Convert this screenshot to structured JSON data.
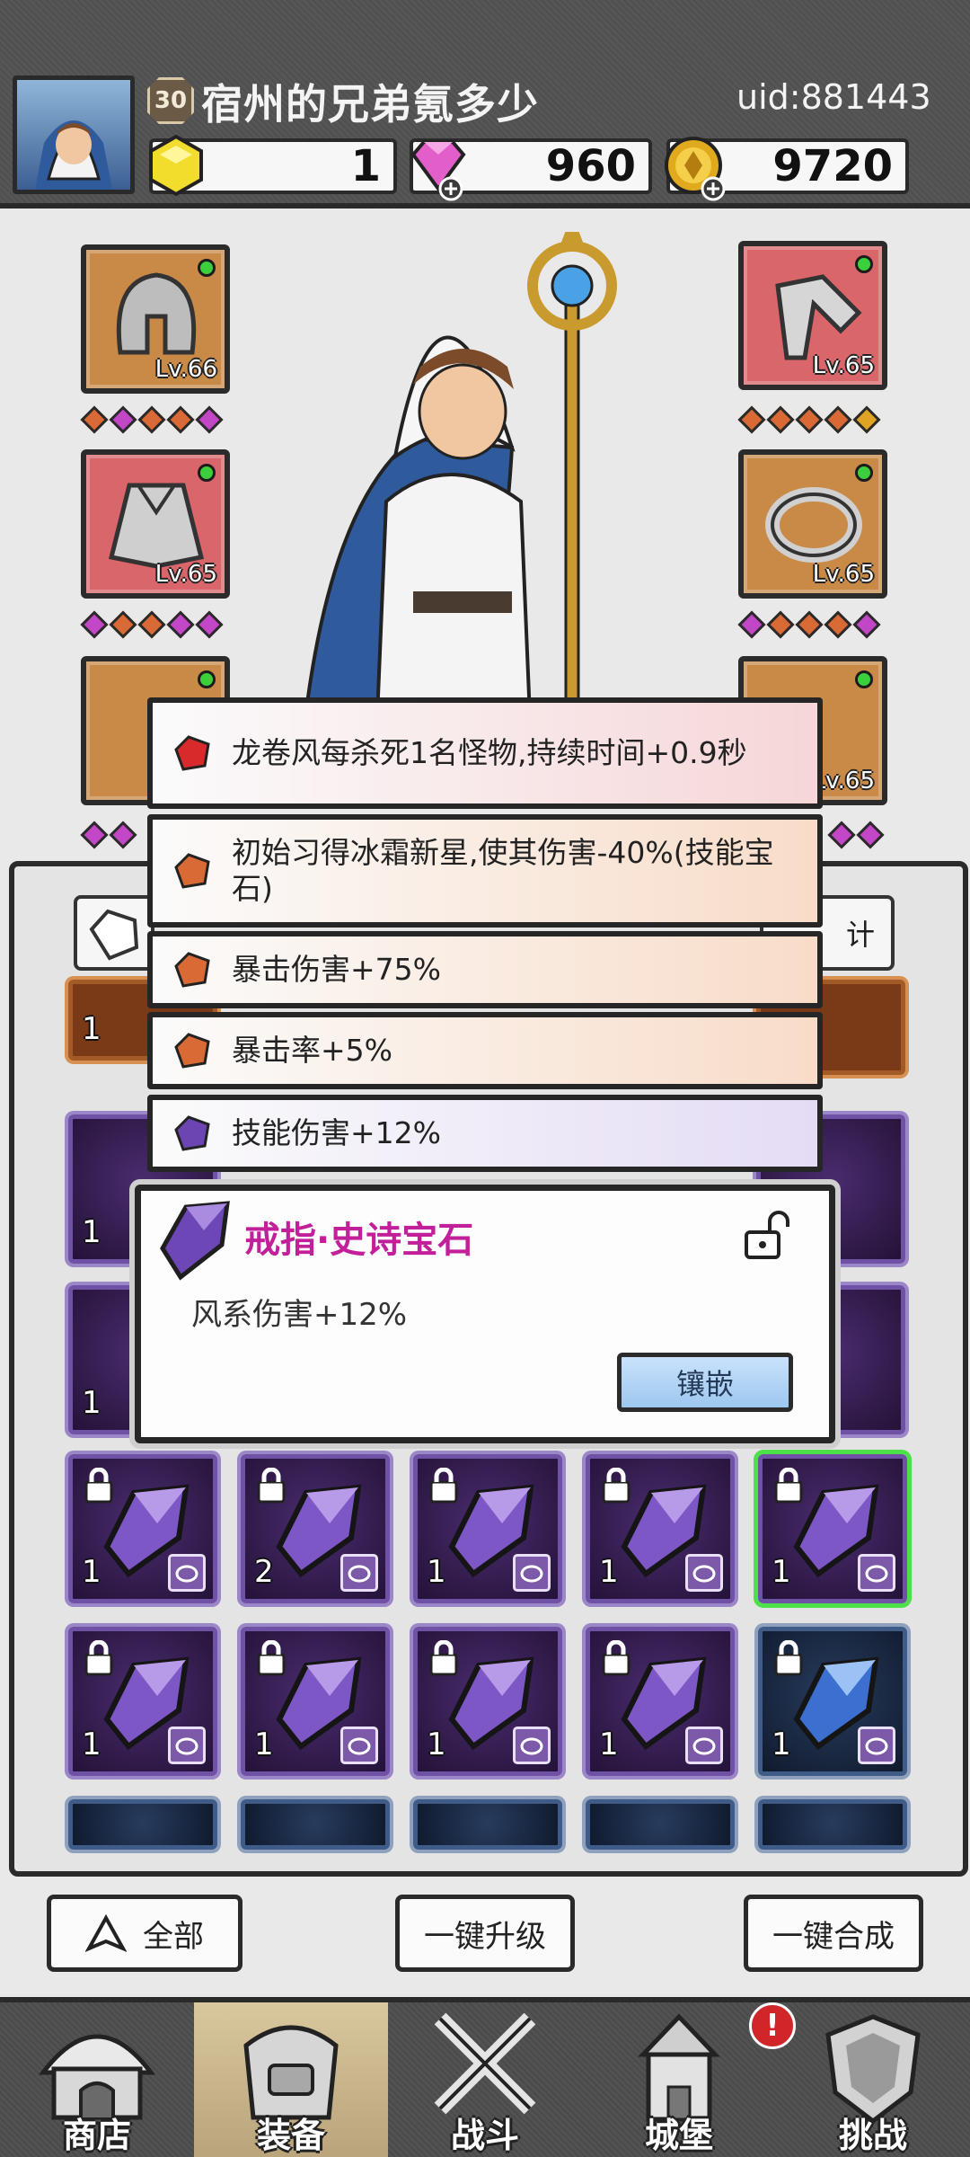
{
  "player": {
    "level": "30",
    "name": "宿州的兄弟氪多少",
    "uid": "uid:881443"
  },
  "resources": {
    "yellow_gem": "1",
    "diamond": "960",
    "gold": "9720"
  },
  "equipment": {
    "left": [
      {
        "name": "helmet",
        "level": "Lv.66"
      },
      {
        "name": "cloak",
        "level": "Lv.65"
      }
    ],
    "right": [
      {
        "name": "boots",
        "level": "Lv.65"
      },
      {
        "name": "ring",
        "level": "Lv.65"
      },
      {
        "name": "necklace",
        "level": "Lv.65"
      }
    ]
  },
  "affixes": [
    {
      "text": "龙卷风每杀死1名怪物,持续时间+0.9秒",
      "color": "#d8292b"
    },
    {
      "text": "初始习得冰霜新星,使其伤害-40%(技能宝石)",
      "color": "#d96a35"
    },
    {
      "text": "暴击伤害+75%",
      "color": "#d96a35"
    },
    {
      "text": "暴击率+5%",
      "color": "#d96a35"
    },
    {
      "text": "技能伤害+12%",
      "color": "#6c45b2"
    }
  ],
  "partial_button_text": "计",
  "gem_popup": {
    "title": "戒指·史诗宝石",
    "effect": "风系伤害+12%",
    "inlay_button": "镶嵌"
  },
  "grid": {
    "row1_counts": [
      "1",
      "2",
      "1",
      "1",
      "1"
    ],
    "row2_counts": [
      "1",
      "1",
      "1",
      "1",
      "1"
    ],
    "side_counts": [
      "1",
      "1",
      "1"
    ]
  },
  "actions": {
    "all": "全部",
    "upgrade_all": "一键升级",
    "merge_all": "一键合成"
  },
  "nav": {
    "shop": "商店",
    "equip": "装备",
    "battle": "战斗",
    "castle": "城堡",
    "challenge": "挑战",
    "alert": "!"
  },
  "colors": {
    "epic_purple": "#6f51a6",
    "rare_blue": "#3f5c88",
    "selected_green": "#4de048",
    "title_magenta": "#c21f9a"
  }
}
